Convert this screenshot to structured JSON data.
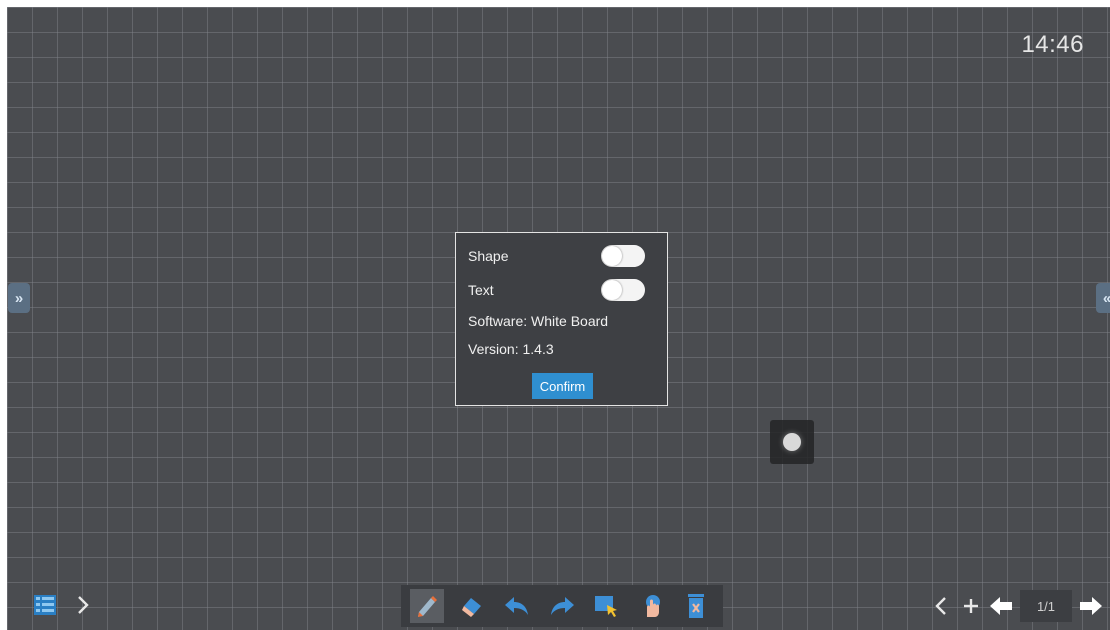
{
  "clock": "14:46",
  "edge_tabs": {
    "left_glyph": "»",
    "right_glyph": "«"
  },
  "settings_dialog": {
    "shape_label": "Shape",
    "shape_enabled": false,
    "text_label": "Text",
    "text_enabled": false,
    "software_text": "Software: White Board",
    "version_text": "Version: 1.4.3",
    "confirm_label": "Confirm"
  },
  "toolbar": {
    "tools": [
      {
        "name": "pen-icon",
        "active": true
      },
      {
        "name": "eraser-icon",
        "active": false
      },
      {
        "name": "undo-icon",
        "active": false
      },
      {
        "name": "redo-icon",
        "active": false
      },
      {
        "name": "select-icon",
        "active": false
      },
      {
        "name": "hand-icon",
        "active": false
      },
      {
        "name": "trash-icon",
        "active": false
      }
    ]
  },
  "pager": {
    "indicator": "1/1"
  },
  "colors": {
    "board_bg": "#4a4c50",
    "grid_line": "#82868c",
    "accent_blue": "#2f8fd0",
    "pen_accent": "#e8703a"
  }
}
